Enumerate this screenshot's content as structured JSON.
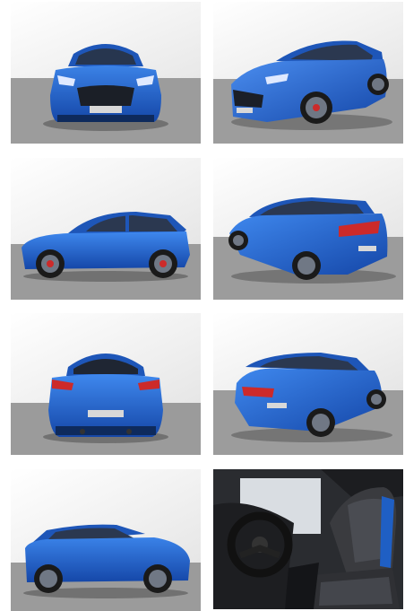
{
  "gallery": {
    "tiles": [
      {
        "view": "front"
      },
      {
        "view": "front-three-quarter-right"
      },
      {
        "view": "side-left"
      },
      {
        "view": "rear-three-quarter-left"
      },
      {
        "view": "rear"
      },
      {
        "view": "rear-three-quarter-right"
      },
      {
        "view": "side-left-alt"
      },
      {
        "view": "interior-driver"
      }
    ]
  },
  "colors": {
    "car_blue": "#1f5fc4",
    "car_blue_dark": "#133f8c",
    "floor_grey": "#9b9b9b",
    "wall_white": "#f4f4f4"
  }
}
